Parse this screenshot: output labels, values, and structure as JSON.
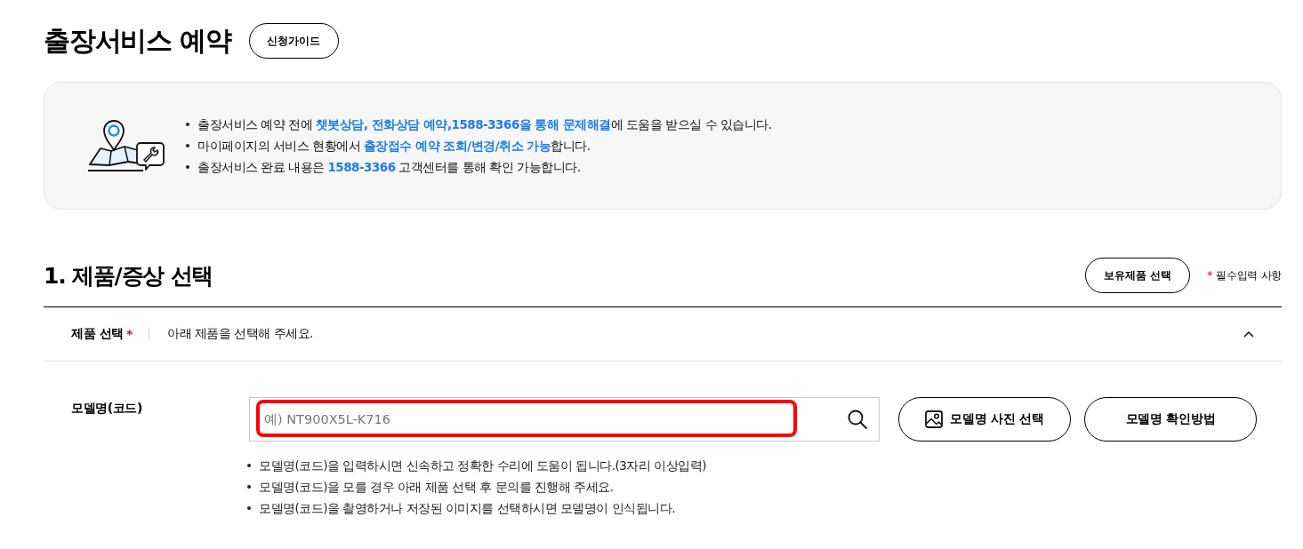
{
  "page_title": "출장서비스 예약",
  "guide_button": "신청가이드",
  "notice": {
    "items": [
      "출장서비스 예약 전에 **챗봇상담, 전화상담 예약,1588-3366을 통해 문제해결**에 도움을 받으실 수 있습니다.",
      "마이페이지의 서비스 현황에서 **출장접수 예약 조회/변경/취소 가능**합니다.",
      "출장서비스 완료 내용은 **1588-3366** 고객센터를 통해 확인 가능합니다."
    ]
  },
  "section": {
    "title": "1. 제품/증상 선택",
    "owned_button": "보유제품 선택",
    "required_note": {
      "mark": "*",
      "text": "필수입력 사항"
    }
  },
  "product_row": {
    "label": "제품 선택",
    "required_mark": "*",
    "value": "아래 제품을 선택해 주세요.",
    "expanded": true
  },
  "model": {
    "label": "모델명(코드)",
    "placeholder": "예) NT900X5L-K716",
    "highlighted": true,
    "buttons": [
      {
        "label": "모델명 사진 선택",
        "kind": "icon"
      },
      {
        "label": "모델명 확인방법",
        "kind": "plain"
      }
    ],
    "hints": [
      "모델명(코드)을 입력하시면 신속하고 정확한 수리에 도움이 됩니다.(3자리 이상입력)",
      "모델명(코드)을 모를 경우 아래 제품 선택 후 문의를 진행해 주세요.",
      "모델명(코드)을 촬영하거나 저장된 이미지를 선택하시면 모델명이 인식됩니다."
    ]
  }
}
